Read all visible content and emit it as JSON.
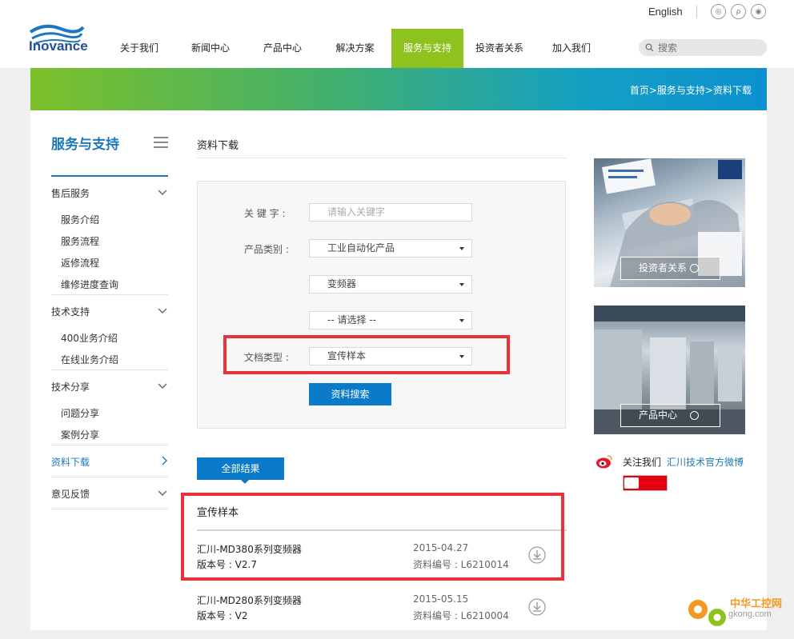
{
  "header": {
    "logo_text": "Inovance",
    "language": "English",
    "social": [
      {
        "icon": "weibo-icon"
      },
      {
        "icon": "tencent-weibo-icon"
      },
      {
        "icon": "wechat-icon"
      }
    ],
    "nav": [
      "关于我们",
      "新闻中心",
      "产品中心",
      "解决方案",
      "服务与支持",
      "投资者关系",
      "加入我们"
    ],
    "nav_active": "服务与支持",
    "search_placeholder": "搜索"
  },
  "banner": {
    "breadcrumb": "首页>服务与支持>资料下载"
  },
  "sidebar": {
    "title": "服务与支持",
    "sections": [
      {
        "label": "售后服务",
        "items": [
          "服务介绍",
          "服务流程",
          "返修流程",
          "维修进度查询"
        ]
      },
      {
        "label": "技术支持",
        "items": [
          "400业务介绍",
          "在线业务介绍"
        ]
      },
      {
        "label": "技术分享",
        "items": [
          "问题分享",
          "案例分享"
        ]
      },
      {
        "label": "资料下载",
        "items": []
      },
      {
        "label": "意见反馈",
        "items": []
      }
    ]
  },
  "main": {
    "page_title": "资料下载",
    "form": {
      "keyword_label": "关 键 字 :",
      "keyword_placeholder": "请输入关键字",
      "category_label": "产品类别 :",
      "category_1": "工业自动化产品",
      "category_2": "变频器",
      "category_3": "-- 请选择 --",
      "doctype_label": "文档类型 :",
      "doctype_value": "宣传样本",
      "submit": "资料搜索"
    },
    "tab_all": "全部结果",
    "section_title": "宣传样本",
    "results": [
      {
        "name": "汇川-MD380系列变频器",
        "version": "版本号 : V2.7",
        "date": "2015-04.27",
        "code": "资料编号 : L6210014"
      },
      {
        "name": "汇川-MD280系列变频器",
        "version": "版本号 : V2",
        "date": "2015-05.15",
        "code": "资料编号 : L6210004"
      }
    ]
  },
  "right": {
    "promo_1": "投资者关系",
    "promo_2": "产品中心",
    "follow_text": "关注我们",
    "follow_link": "汇川技术官方微博"
  },
  "watermark": {
    "line1": "中华工控网",
    "line2": "gkong.com"
  },
  "colors": {
    "accent_blue": "#0b7bc9",
    "nav_active": "#8dc21f",
    "highlight_red": "#e8323c"
  }
}
